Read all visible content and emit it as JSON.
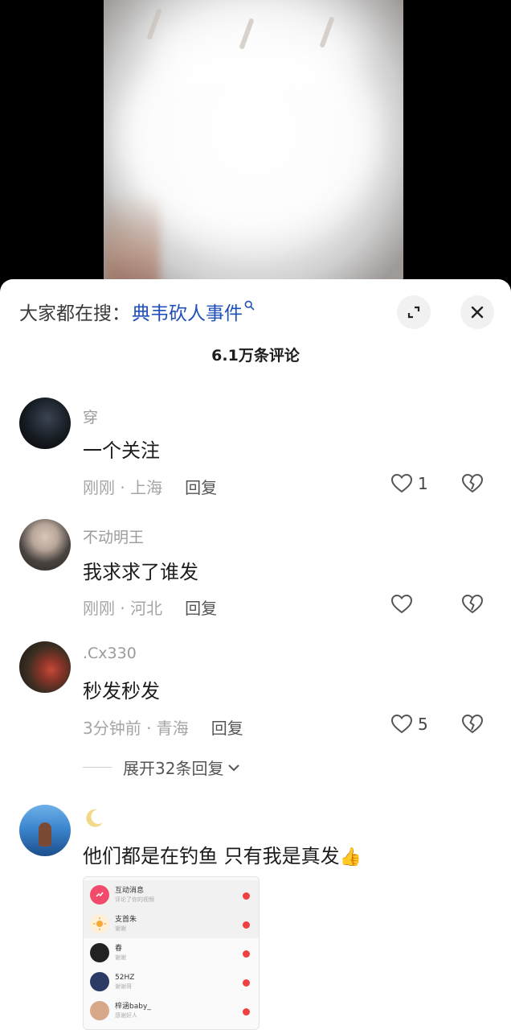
{
  "video": {
    "description_icon": "video-frame"
  },
  "sheet": {
    "search_prefix": "大家都在搜：",
    "search_term": "典韦砍人事件",
    "comment_count": "6.1万条评论"
  },
  "comments": [
    {
      "user": "穿",
      "text": "一个关注",
      "time_loc": "刚刚 · 上海",
      "reply": "回复",
      "likes": "1"
    },
    {
      "user": "不动明王",
      "text": "我求求了谁发",
      "time_loc": "刚刚 · 河北",
      "reply": "回复",
      "likes": ""
    },
    {
      "user": ".Cx330",
      "text": "秒发秒发",
      "time_loc": "3分钟前 · 青海",
      "reply": "回复",
      "likes": "5"
    },
    {
      "user": "",
      "text": "他们都是在钓鱼 只有我是真发",
      "time_loc": "",
      "reply": "",
      "likes": ""
    }
  ],
  "expand_replies": "展开32条回复",
  "attachment": {
    "rows": [
      {
        "name": "互动消息",
        "sub": "评论了你的视频",
        "color": "#f24a6a"
      },
      {
        "name": "支首朱",
        "sub": "谢谢",
        "color": "#f5b84a"
      },
      {
        "name": "春",
        "sub": "谢谢",
        "color": "#222222"
      },
      {
        "name": "52HZ",
        "sub": "谢谢哥",
        "color": "#2b3b66"
      },
      {
        "name": "梓涵baby_",
        "sub": "感谢好人",
        "color": "#d8a88a"
      }
    ]
  },
  "colors": {
    "accent_blue": "#1f4fb8",
    "text_gray": "#9b9b9b"
  }
}
